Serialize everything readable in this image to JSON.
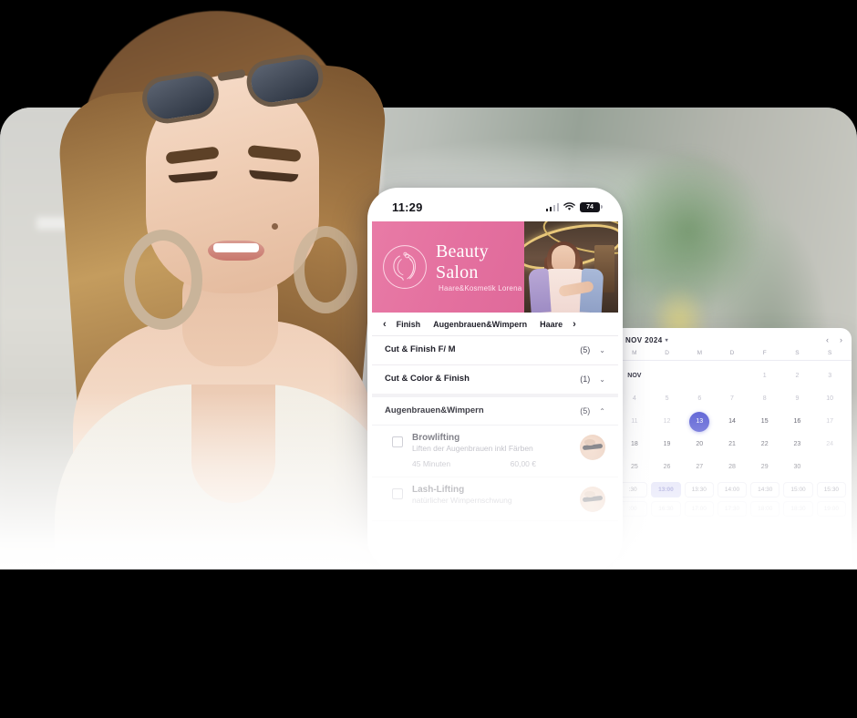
{
  "phone": {
    "status_bar": {
      "time": "11:29",
      "battery_level": "74",
      "signal_icon": "signal-bars-icon",
      "wifi_icon": "wifi-icon"
    },
    "banner": {
      "brand_name": "Beauty Salon",
      "brand_subtitle": "Haare&Kosmetik Lorena",
      "logo_icon": "woman-hair-logo-icon",
      "background_color": "#e4709f"
    },
    "tabs": {
      "prev_icon": "chevron-left-icon",
      "next_icon": "chevron-right-icon",
      "items": [
        {
          "label": "Finish"
        },
        {
          "label": "Augenbrauen&Wimpern"
        },
        {
          "label": "Haare"
        }
      ]
    },
    "groups": [
      {
        "title": "Cut & Finish F/ M",
        "count": "(5)",
        "chevron": "⌄",
        "expanded": false
      },
      {
        "title": "Cut & Color & Finish",
        "count": "(1)",
        "chevron": "⌄",
        "expanded": false
      },
      {
        "title": "Augenbrauen&Wimpern",
        "count": "(5)",
        "chevron": "⌃",
        "expanded": true
      }
    ],
    "services": [
      {
        "name": "Browlifting",
        "description": "Liften der Augenbrauen inkl Färben",
        "duration": "45 Minuten",
        "price": "60,00 €",
        "thumb_icon": "eyebrow-photo-thumbnail",
        "checked": false
      },
      {
        "name": "Lash-Lifting",
        "description": "natürlicher Wimpernschwung",
        "duration": "",
        "price": "",
        "thumb_icon": "eyelash-photo-thumbnail",
        "checked": false
      }
    ]
  },
  "calendar": {
    "month_label": "NOV 2024",
    "month_caret_icon": "chevron-down-icon",
    "prev_icon": "chevron-left-icon",
    "next_icon": "chevron-right-icon",
    "weekdays": [
      "M",
      "D",
      "M",
      "D",
      "F",
      "S",
      "S"
    ],
    "selected_day": "13",
    "selected_color": "#4a4fd0",
    "weeks": [
      [
        {
          "t": "NOV",
          "s": "label"
        },
        {
          "t": "",
          "s": "empty"
        },
        {
          "t": "",
          "s": "empty"
        },
        {
          "t": "",
          "s": "empty"
        },
        {
          "t": "1",
          "s": "muted"
        },
        {
          "t": "2",
          "s": "muted"
        },
        {
          "t": "3",
          "s": "muted"
        }
      ],
      [
        {
          "t": "4",
          "s": "muted"
        },
        {
          "t": "5",
          "s": "muted"
        },
        {
          "t": "6",
          "s": "muted"
        },
        {
          "t": "7",
          "s": "muted"
        },
        {
          "t": "8",
          "s": "muted"
        },
        {
          "t": "9",
          "s": "muted"
        },
        {
          "t": "10",
          "s": "muted"
        }
      ],
      [
        {
          "t": "11",
          "s": "muted"
        },
        {
          "t": "12",
          "s": "muted"
        },
        {
          "t": "13",
          "s": "sel"
        },
        {
          "t": "14",
          "s": ""
        },
        {
          "t": "15",
          "s": ""
        },
        {
          "t": "16",
          "s": ""
        },
        {
          "t": "17",
          "s": "muted"
        }
      ],
      [
        {
          "t": "18",
          "s": ""
        },
        {
          "t": "19",
          "s": ""
        },
        {
          "t": "20",
          "s": ""
        },
        {
          "t": "21",
          "s": ""
        },
        {
          "t": "22",
          "s": ""
        },
        {
          "t": "23",
          "s": ""
        },
        {
          "t": "24",
          "s": "muted"
        }
      ],
      [
        {
          "t": "25",
          "s": ""
        },
        {
          "t": "26",
          "s": ""
        },
        {
          "t": "27",
          "s": ""
        },
        {
          "t": "28",
          "s": ""
        },
        {
          "t": "29",
          "s": ""
        },
        {
          "t": "30",
          "s": ""
        },
        {
          "t": "",
          "s": "empty"
        }
      ]
    ],
    "time_slots_row1": [
      {
        "label": ":30",
        "state": ""
      },
      {
        "label": "13:00",
        "state": "active"
      },
      {
        "label": "13:30",
        "state": ""
      },
      {
        "label": "14:00",
        "state": ""
      },
      {
        "label": "14:30",
        "state": ""
      },
      {
        "label": "15:00",
        "state": ""
      },
      {
        "label": "15:30",
        "state": ""
      }
    ],
    "time_slots_row2": [
      {
        "label": ":00",
        "state": "dim"
      },
      {
        "label": "16:30",
        "state": "dim"
      },
      {
        "label": "17:00",
        "state": "dim"
      },
      {
        "label": "17:30",
        "state": "dim"
      },
      {
        "label": "18:00",
        "state": "dim"
      },
      {
        "label": "18:30",
        "state": "dim"
      },
      {
        "label": "19:00",
        "state": "dim"
      }
    ]
  }
}
